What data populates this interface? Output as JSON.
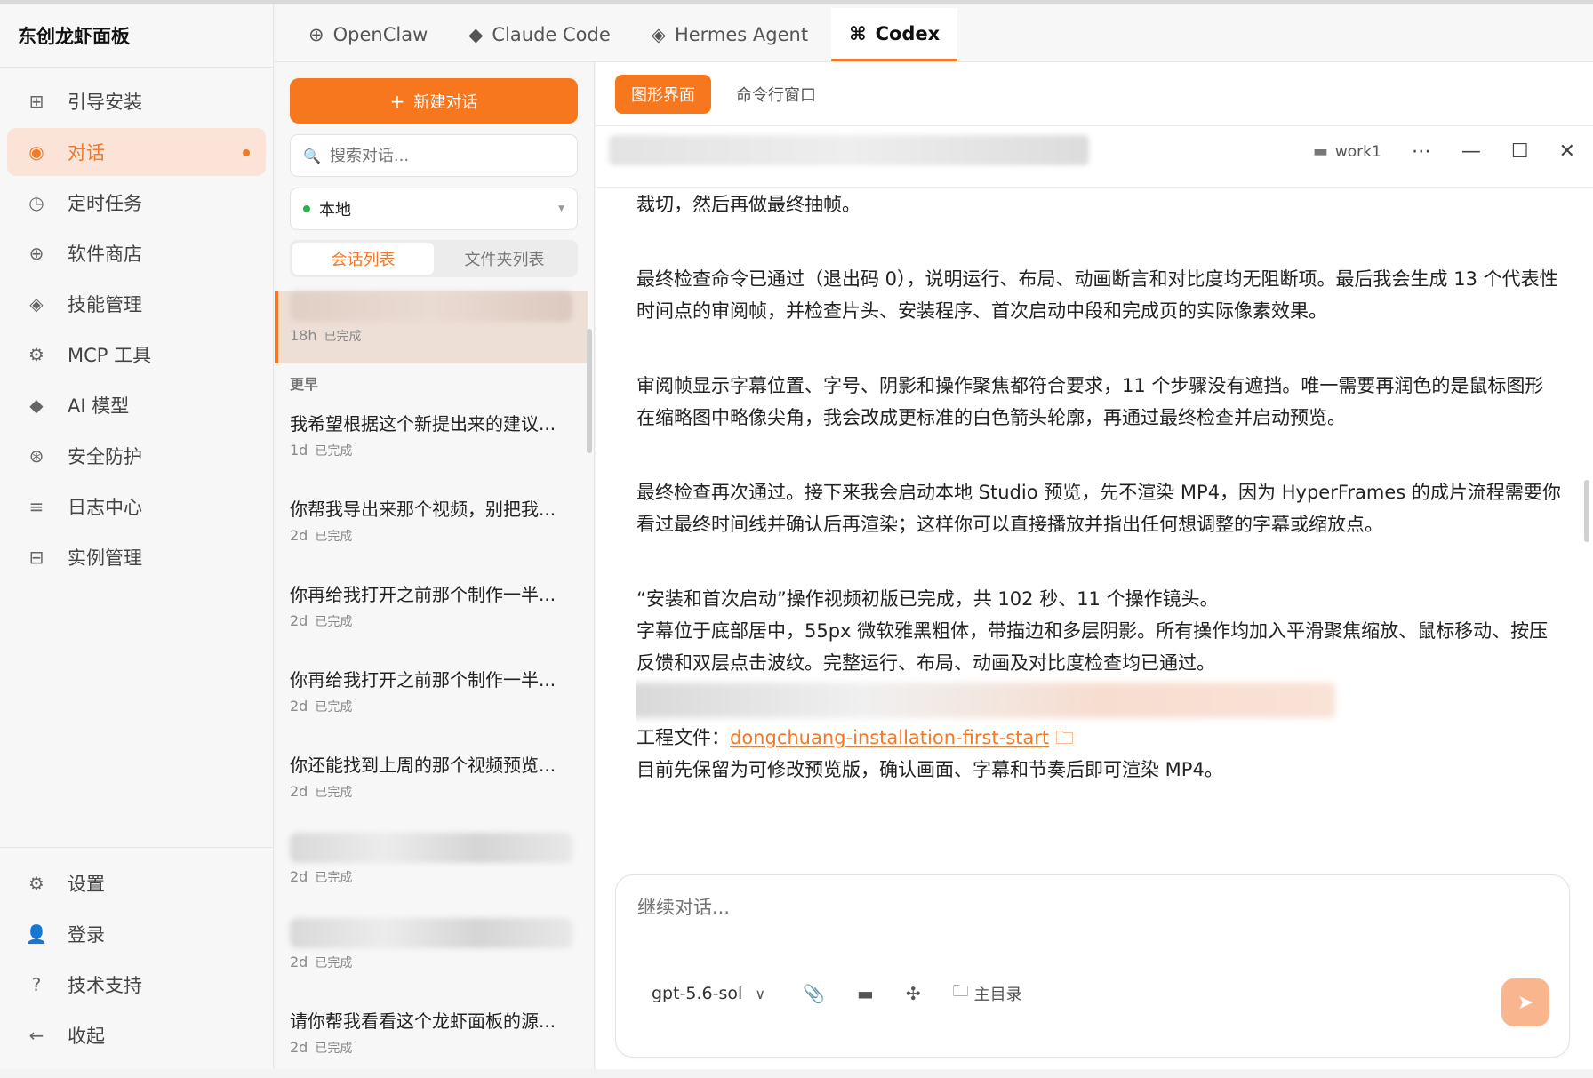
{
  "app": {
    "title": "东创龙虾面板"
  },
  "sidebar": {
    "items": [
      {
        "label": "引导安装",
        "icon": "grid-icon"
      },
      {
        "label": "对话",
        "icon": "chat-icon",
        "active": true
      },
      {
        "label": "定时任务",
        "icon": "clock-icon"
      },
      {
        "label": "软件商店",
        "icon": "store-icon"
      },
      {
        "label": "技能管理",
        "icon": "diamond-icon"
      },
      {
        "label": "MCP 工具",
        "icon": "gear-icon"
      },
      {
        "label": "AI 模型",
        "icon": "sparkle-icon"
      },
      {
        "label": "安全防护",
        "icon": "shield-icon"
      },
      {
        "label": "日志中心",
        "icon": "list-icon"
      },
      {
        "label": "实例管理",
        "icon": "instance-icon"
      }
    ],
    "bottom": [
      {
        "label": "设置",
        "icon": "gear-icon"
      },
      {
        "label": "登录",
        "icon": "user-icon"
      },
      {
        "label": "技术支持",
        "icon": "help-icon"
      },
      {
        "label": "收起",
        "icon": "arrow-left-icon"
      }
    ]
  },
  "tabs": [
    {
      "label": "OpenClaw",
      "icon": "globe-icon"
    },
    {
      "label": "Claude Code",
      "icon": "diamond-icon"
    },
    {
      "label": "Hermes Agent",
      "icon": "hermes-icon"
    },
    {
      "label": "Codex",
      "icon": "command-icon",
      "active": true
    }
  ],
  "conversations": {
    "new_button": "新建对话",
    "search_placeholder": "搜索对话...",
    "location": "本地",
    "segments": [
      "会话列表",
      "文件夹列表"
    ],
    "selected_item": {
      "time": "18h",
      "status": "已完成"
    },
    "group_label": "更早",
    "items": [
      {
        "title": "我希望根据这个新提出来的建议...",
        "time": "1d",
        "status": "已完成"
      },
      {
        "title": "你帮我导出来那个视频，别把我...",
        "time": "2d",
        "status": "已完成"
      },
      {
        "title": "你再给我打开之前那个制作一半...",
        "time": "2d",
        "status": "已完成"
      },
      {
        "title": "你再给我打开之前那个制作一半...",
        "time": "2d",
        "status": "已完成"
      },
      {
        "title": "你还能找到上周的那个视频预览...",
        "time": "2d",
        "status": "已完成"
      },
      {
        "title": "",
        "time": "2d",
        "status": "已完成",
        "blurred": true
      },
      {
        "title": "",
        "time": "2d",
        "status": "已完成",
        "blurred": true
      },
      {
        "title": "请你帮我看看这个龙虾面板的源...",
        "time": "2d",
        "status": "已完成"
      }
    ]
  },
  "chat": {
    "modes": [
      "图形界面",
      "命令行窗口"
    ],
    "folder": "work1",
    "messages": {
      "p1": "裁切，然后再做最终抽帧。",
      "p2": "最终检查命令已通过（退出码 0），说明运行、布局、动画断言和对比度均无阻断项。最后我会生成 13 个代表性时间点的审阅帧，并检查片头、安装程序、首次启动中段和完成页的实际像素效果。",
      "p3": "审阅帧显示字幕位置、字号、阴影和操作聚焦都符合要求，11 个步骤没有遮挡。唯一需要再润色的是鼠标图形在缩略图中略像尖角，我会改成更标准的白色箭头轮廓，再通过最终检查并启动预览。",
      "p4": "最终检查再次通过。接下来我会启动本地 Studio 预览，先不渲染 MP4，因为 HyperFrames 的成片流程需要你看过最终时间线并确认后再渲染；这样你可以直接播放并指出任何想调整的字幕或缩放点。",
      "p5": "“安装和首次启动”操作视频初版已完成，共 102 秒、11 个操作镜头。",
      "p6": "字幕位于底部居中，55px 微软雅黑粗体，带描边和多层阴影。所有操作均加入平滑聚焦缩放、鼠标移动、按压反馈和双层点击波纹。完整运行、布局、动画及对比度检查均已通过。",
      "project_label": "工程文件：",
      "project_link": "dongchuang-installation-first-start",
      "p7": "目前先保留为可修改预览版，确认画面、字幕和节奏后即可渲染 MP4。"
    },
    "input_placeholder": "继续对话...",
    "model": "gpt-5.6-sol",
    "dir_label": "主目录"
  }
}
